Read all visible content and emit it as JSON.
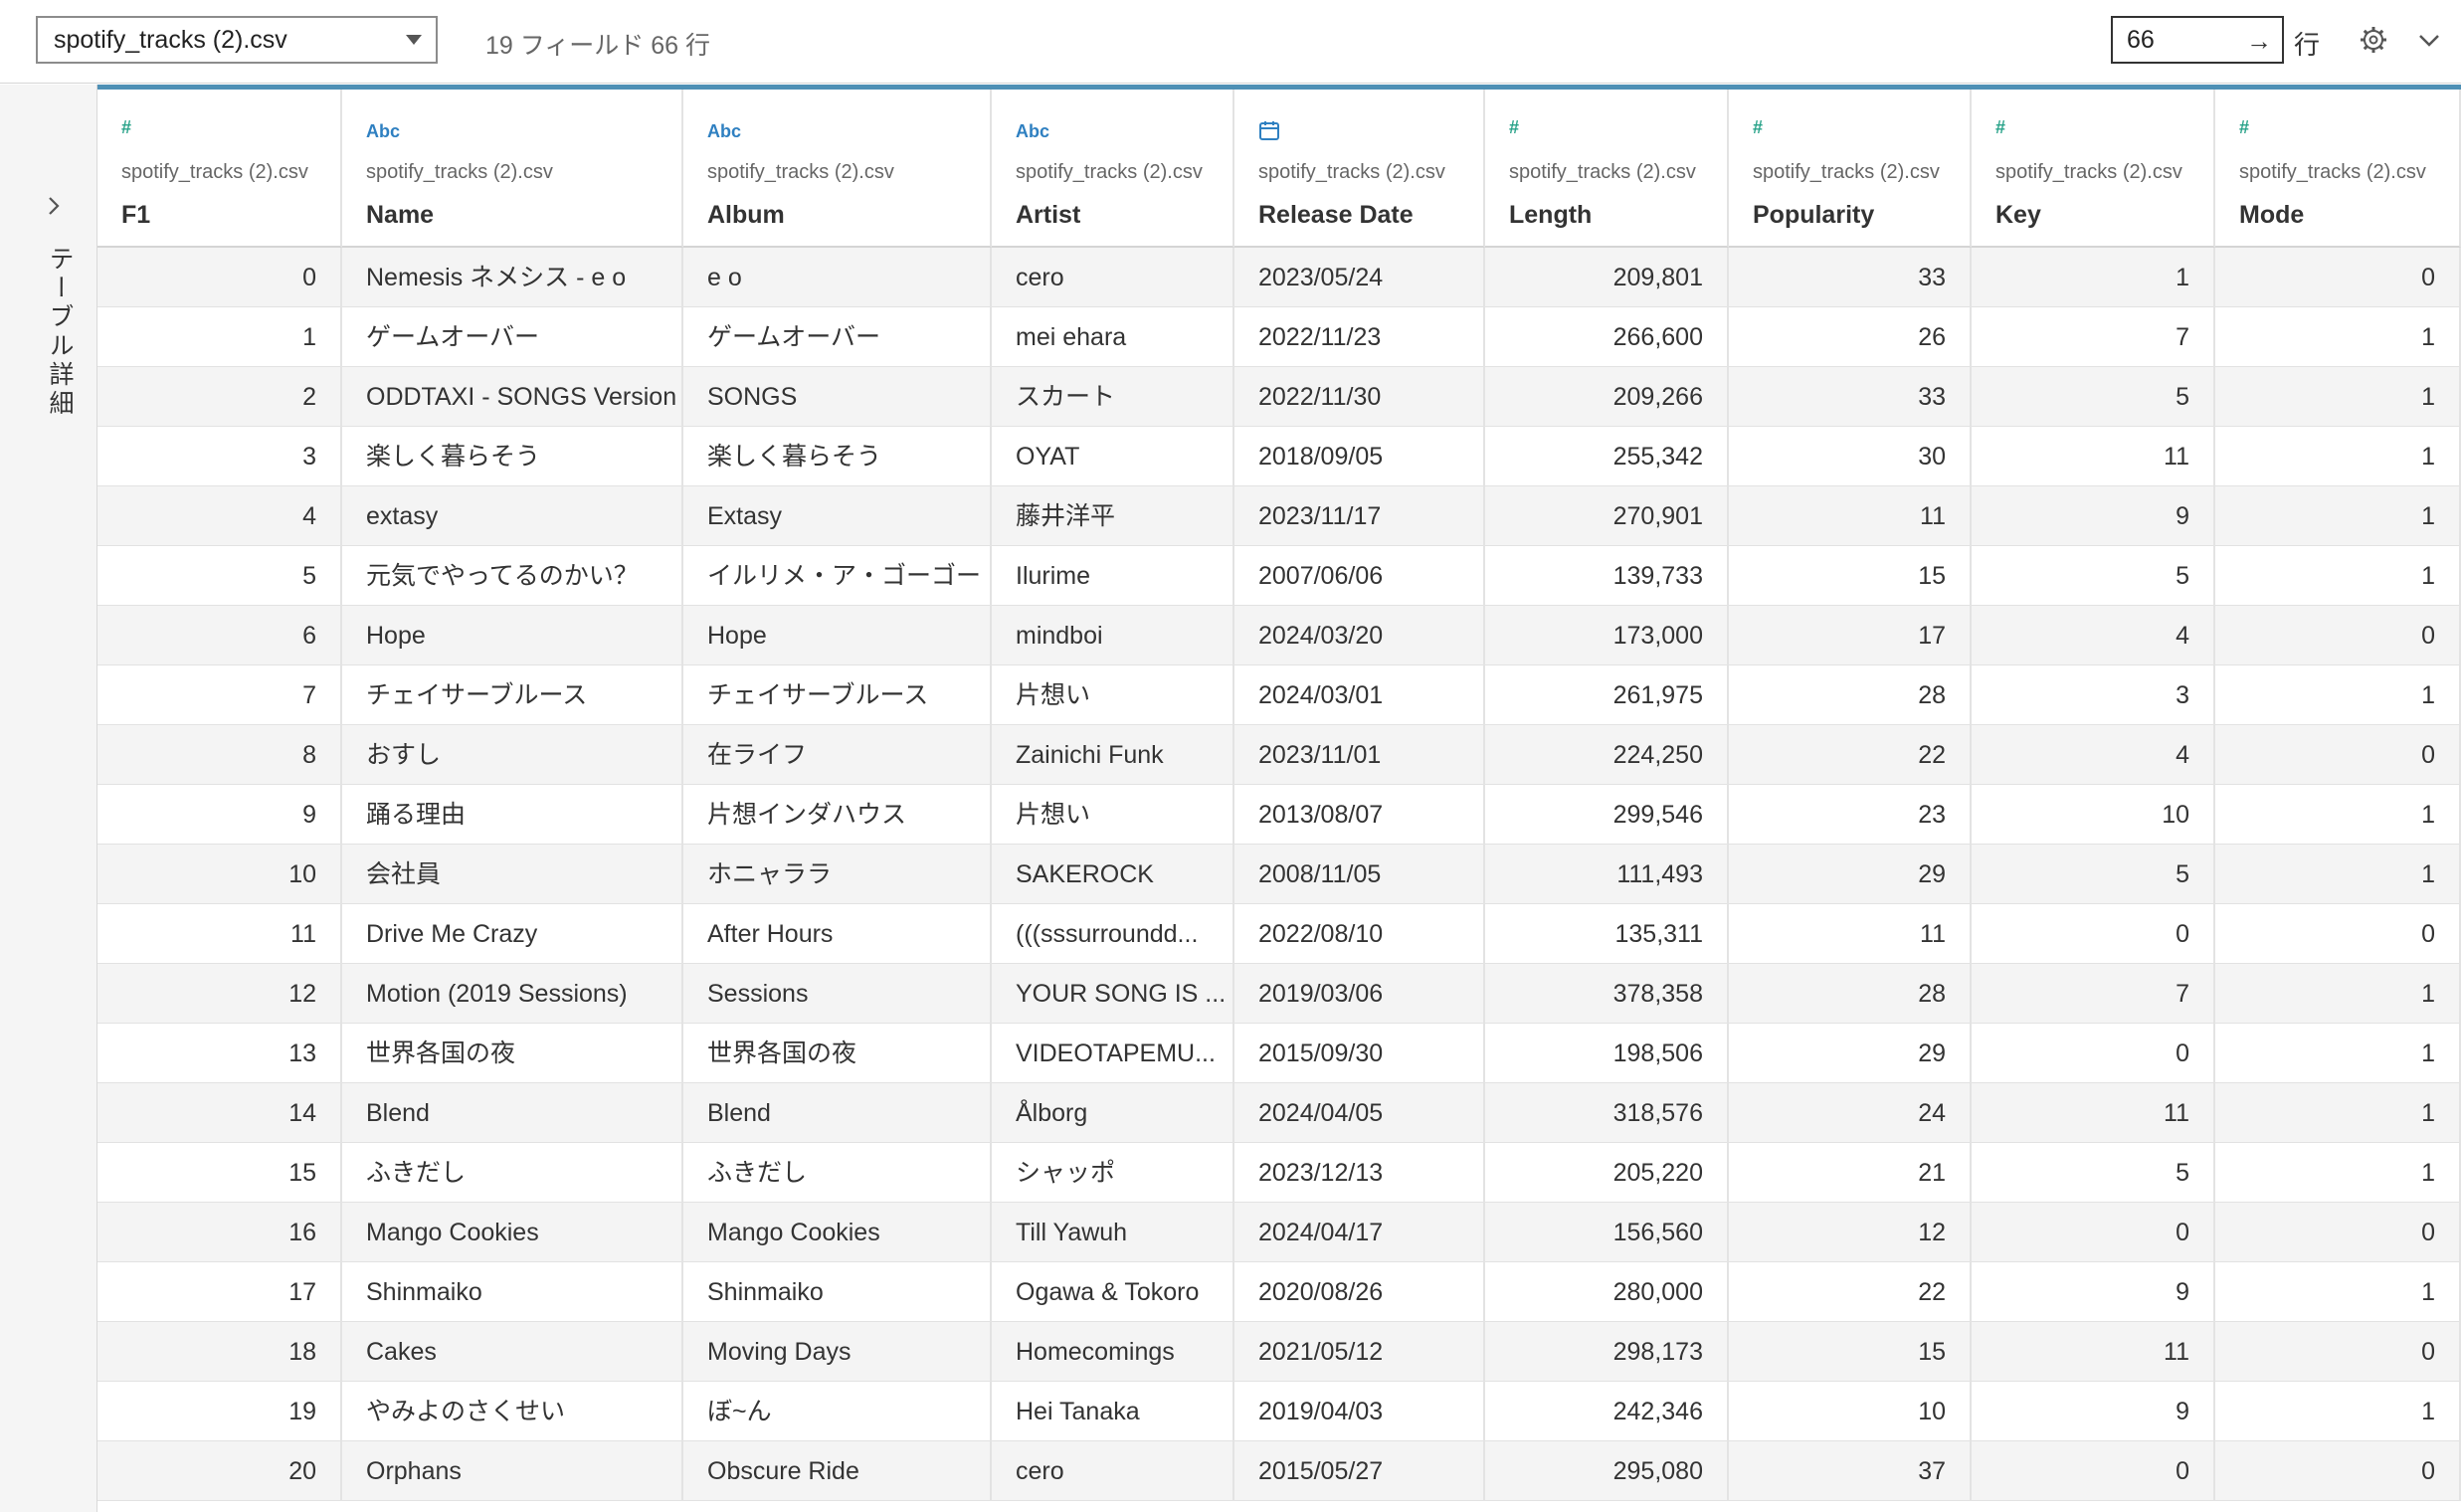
{
  "toolbar": {
    "source_name": "spotify_tracks (2).csv",
    "field_summary": "19 フィールド 66 行",
    "rows_value": "66",
    "go_arrow": "→",
    "rows_unit": "行"
  },
  "side_panel": {
    "toggle": "›",
    "label": "テーブル詳細"
  },
  "accent_color": "#4e90b5",
  "columns": [
    {
      "type": "number",
      "icon": "#",
      "source": "spotify_tracks (2).csv",
      "name": "F1"
    },
    {
      "type": "string",
      "icon": "Abc",
      "source": "spotify_tracks (2).csv",
      "name": "Name"
    },
    {
      "type": "string",
      "icon": "Abc",
      "source": "spotify_tracks (2).csv",
      "name": "Album"
    },
    {
      "type": "string",
      "icon": "Abc",
      "source": "spotify_tracks (2).csv",
      "name": "Artist"
    },
    {
      "type": "date",
      "icon": "calendar",
      "source": "spotify_tracks (2).csv",
      "name": "Release Date"
    },
    {
      "type": "number",
      "icon": "#",
      "source": "spotify_tracks (2).csv",
      "name": "Length"
    },
    {
      "type": "number",
      "icon": "#",
      "source": "spotify_tracks (2).csv",
      "name": "Popularity"
    },
    {
      "type": "number",
      "icon": "#",
      "source": "spotify_tracks (2).csv",
      "name": "Key"
    },
    {
      "type": "number",
      "icon": "#",
      "source": "spotify_tracks (2).csv",
      "name": "Mode"
    }
  ],
  "rows": [
    [
      "0",
      "Nemesis ネメシス - e o",
      "e o",
      "cero",
      "2023/05/24",
      "209,801",
      "33",
      "1",
      "0"
    ],
    [
      "1",
      "ゲームオーバー",
      "ゲームオーバー",
      "mei ehara",
      "2022/11/23",
      "266,600",
      "26",
      "7",
      "1"
    ],
    [
      "2",
      "ODDTAXI - SONGS Version",
      "SONGS",
      "スカート",
      "2022/11/30",
      "209,266",
      "33",
      "5",
      "1"
    ],
    [
      "3",
      "楽しく暮らそう",
      "楽しく暮らそう",
      "OYAT",
      "2018/09/05",
      "255,342",
      "30",
      "11",
      "1"
    ],
    [
      "4",
      "extasy",
      "Extasy",
      "藤井洋平",
      "2023/11/17",
      "270,901",
      "11",
      "9",
      "1"
    ],
    [
      "5",
      "元気でやってるのかい？",
      "イルリメ・ア・ゴーゴー",
      "Ilurime",
      "2007/06/06",
      "139,733",
      "15",
      "5",
      "1"
    ],
    [
      "6",
      "Hope",
      "Hope",
      "mindboi",
      "2024/03/20",
      "173,000",
      "17",
      "4",
      "0"
    ],
    [
      "7",
      "チェイサーブルース",
      "チェイサーブルース",
      "片想い",
      "2024/03/01",
      "261,975",
      "28",
      "3",
      "1"
    ],
    [
      "8",
      "おすし",
      "在ライフ",
      "Zainichi Funk",
      "2023/11/01",
      "224,250",
      "22",
      "4",
      "0"
    ],
    [
      "9",
      "踊る理由",
      "片想インダハウス",
      "片想い",
      "2013/08/07",
      "299,546",
      "23",
      "10",
      "1"
    ],
    [
      "10",
      "会社員",
      "ホニャララ",
      "SAKEROCK",
      "2008/11/05",
      "111,493",
      "29",
      "5",
      "1"
    ],
    [
      "11",
      "Drive Me Crazy",
      "After Hours",
      "(((sssurroundd...",
      "2022/08/10",
      "135,311",
      "11",
      "0",
      "0"
    ],
    [
      "12",
      "Motion (2019 Sessions)",
      "Sessions",
      "YOUR SONG IS ...",
      "2019/03/06",
      "378,358",
      "28",
      "7",
      "1"
    ],
    [
      "13",
      "世界各国の夜",
      "世界各国の夜",
      "VIDEOTAPEMU...",
      "2015/09/30",
      "198,506",
      "29",
      "0",
      "1"
    ],
    [
      "14",
      "Blend",
      "Blend",
      "Ålborg",
      "2024/04/05",
      "318,576",
      "24",
      "11",
      "1"
    ],
    [
      "15",
      "ふきだし",
      "ふきだし",
      "シャッポ",
      "2023/12/13",
      "205,220",
      "21",
      "5",
      "1"
    ],
    [
      "16",
      "Mango Cookies",
      "Mango Cookies",
      "Till Yawuh",
      "2024/04/17",
      "156,560",
      "12",
      "0",
      "0"
    ],
    [
      "17",
      "Shinmaiko",
      "Shinmaiko",
      "Ogawa & Tokoro",
      "2020/08/26",
      "280,000",
      "22",
      "9",
      "1"
    ],
    [
      "18",
      "Cakes",
      "Moving Days",
      "Homecomings",
      "2021/05/12",
      "298,173",
      "15",
      "11",
      "0"
    ],
    [
      "19",
      "やみよのさくせい",
      "ぼ~ん",
      "Hei Tanaka",
      "2019/04/03",
      "242,346",
      "10",
      "9",
      "1"
    ],
    [
      "20",
      "Orphans",
      "Obscure Ride",
      "cero",
      "2015/05/27",
      "295,080",
      "37",
      "0",
      "0"
    ]
  ]
}
